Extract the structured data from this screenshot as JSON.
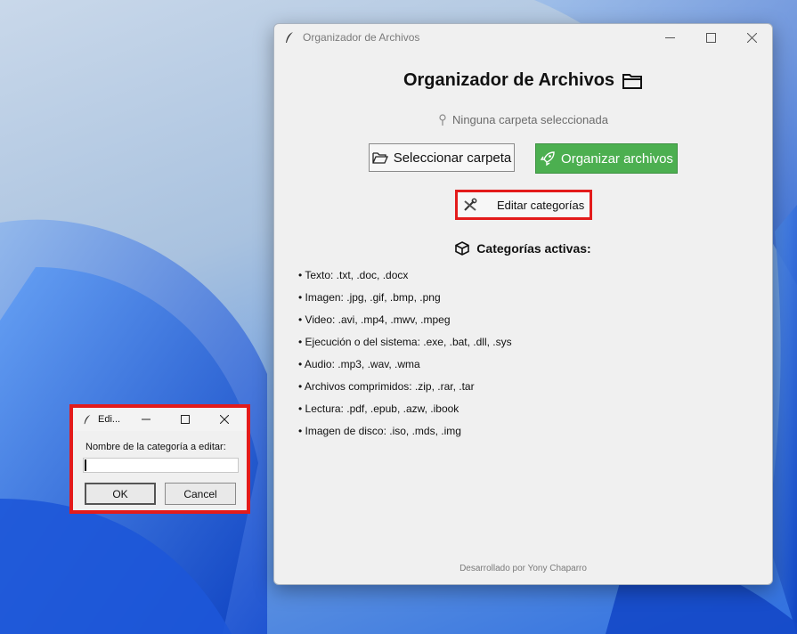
{
  "main_window": {
    "title": "Organizador de Archivos",
    "heading": "Organizador de Archivos",
    "heading_icon": "folder-icon",
    "status": "Ninguna carpeta seleccionada",
    "status_icon": "pin-icon",
    "select_folder_label": "Seleccionar carpeta",
    "organize_label": "Organizar archivos",
    "organize_color": "#4caf50",
    "edit_categories_label": "Editar categorías",
    "active_categories_heading": "Categorías activas:",
    "categories": [
      "• Texto: .txt, .doc, .docx",
      "• Imagen: .jpg, .gif, .bmp, .png",
      "• Video: .avi, .mp4, .mwv, .mpeg",
      "• Ejecución o del sistema: .exe, .bat, .dll, .sys",
      "• Audio: .mp3, .wav, .wma",
      "• Archivos comprimidos: .zip, .rar, .tar",
      "• Lectura: .pdf, .epub, .azw, .ibook",
      "• Imagen de disco: .iso, .mds, .img"
    ],
    "footer": "Desarrollado por Yony Chaparro"
  },
  "dialog": {
    "title": "Edi...",
    "prompt": "Nombre de la categoría a editar:",
    "input_value": "",
    "ok_label": "OK",
    "cancel_label": "Cancel"
  },
  "highlight_color": "#e31b1b"
}
